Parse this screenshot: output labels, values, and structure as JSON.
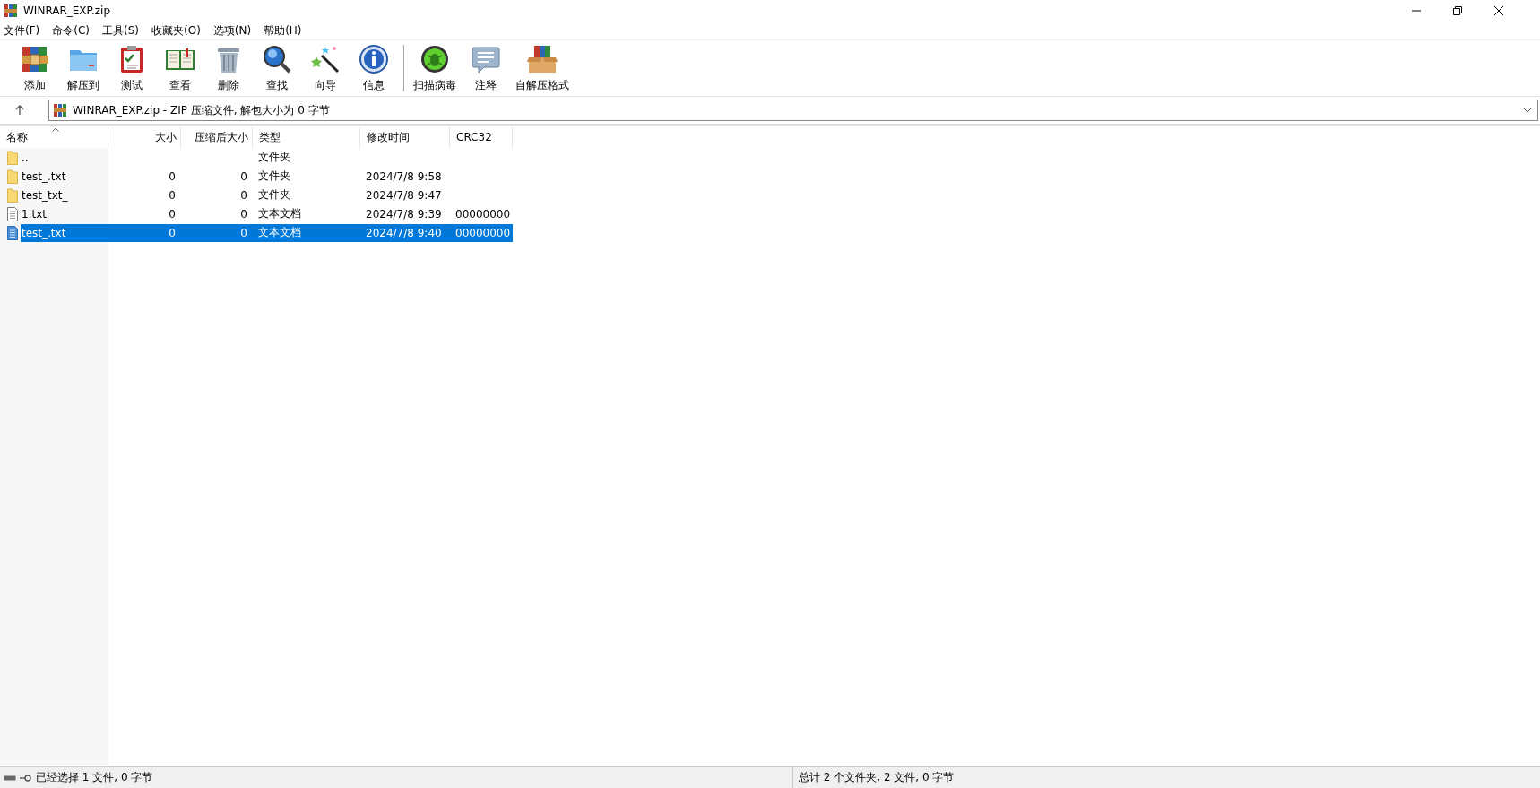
{
  "window": {
    "title": "WINRAR_EXP.zip"
  },
  "menu": [
    "文件(F)",
    "命令(C)",
    "工具(S)",
    "收藏夹(O)",
    "选项(N)",
    "帮助(H)"
  ],
  "toolbar": [
    {
      "label": "添加"
    },
    {
      "label": "解压到"
    },
    {
      "label": "测试"
    },
    {
      "label": "查看"
    },
    {
      "label": "删除"
    },
    {
      "label": "查找"
    },
    {
      "label": "向导"
    },
    {
      "label": "信息"
    },
    {
      "label": "扫描病毒"
    },
    {
      "label": "注释"
    },
    {
      "label": "自解压格式"
    }
  ],
  "address": {
    "value": "WINRAR_EXP.zip - ZIP 压缩文件, 解包大小为 0 字节"
  },
  "table": {
    "columns": [
      "名称",
      "大小",
      "压缩后大小",
      "类型",
      "修改时间",
      "CRC32"
    ],
    "rows": [
      {
        "kind": "folder",
        "name": "..",
        "type": "文件夹",
        "selected": false
      },
      {
        "kind": "folder",
        "name": "test_.txt",
        "size": "0",
        "packed": "0",
        "type": "文件夹",
        "modified": "2024/7/8 9:58",
        "selected": false
      },
      {
        "kind": "folder",
        "name": "test_txt_",
        "size": "0",
        "packed": "0",
        "type": "文件夹",
        "modified": "2024/7/8 9:47",
        "selected": false
      },
      {
        "kind": "file",
        "name": "1.txt",
        "size": "0",
        "packed": "0",
        "type": "文本文档",
        "modified": "2024/7/8 9:39",
        "crc": "00000000",
        "selected": false
      },
      {
        "kind": "file",
        "name": "test_.txt",
        "size": "0",
        "packed": "0",
        "type": "文本文档",
        "modified": "2024/7/8 9:40",
        "crc": "00000000",
        "selected": true
      }
    ]
  },
  "status_bar": {
    "left": "已经选择 1 文件, 0 字节",
    "right": "总计 2 个文件夹, 2 文件, 0 字节"
  }
}
